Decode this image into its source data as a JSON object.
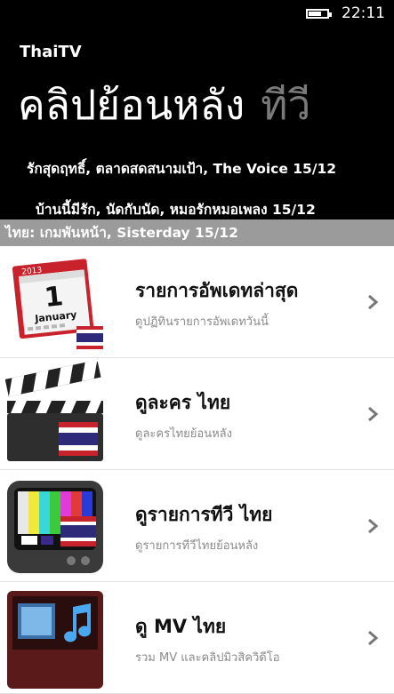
{
  "status": {
    "time": "22:11"
  },
  "header": {
    "app_name": "ThaiTV",
    "pivot_active": "คลิปย้อนหลัง",
    "pivot_next": "ทีวี"
  },
  "headlines": [
    "รักสุดฤทธิ์, ตลาดสดสนามเป้า, The Voice 15/12",
    "บ้านนี้มีรัก, นัดกับนัด, หมอรักหมอเพลง 15/12"
  ],
  "ticker": "ไทย: เกมพันหน้า, Sisterday 15/12",
  "items": [
    {
      "title": "รายการอัพเดทล่าสุด",
      "subtitle": "ดูปฏิทินรายการอัพเดทวันนี้",
      "icon": "calendar-icon",
      "calendar_year": "2013",
      "calendar_day": "1",
      "calendar_month": "January"
    },
    {
      "title": "ดูละคร ไทย",
      "subtitle": "ดูละครไทยย้อนหลัง",
      "icon": "clapperboard-icon"
    },
    {
      "title": "ดูรายการทีวี ไทย",
      "subtitle": "ดูรายการทีวีไทยย้อนหลัง",
      "icon": "tv-icon"
    },
    {
      "title": "ดู MV ไทย",
      "subtitle": "รวม MV และคลิปมิวสิควิดีโอ",
      "icon": "music-icon"
    }
  ]
}
